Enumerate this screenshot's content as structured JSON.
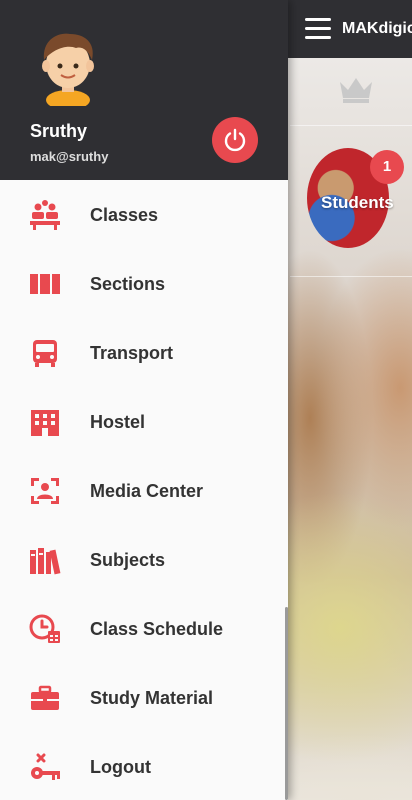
{
  "app": {
    "title": "MAKdigica",
    "tile": {
      "label": "Students",
      "badge": "1"
    }
  },
  "drawer": {
    "user": {
      "name": "Sruthy",
      "email": "mak@sruthy"
    },
    "items": [
      {
        "label": "Classes",
        "icon": "classroom-icon"
      },
      {
        "label": "Sections",
        "icon": "sections-icon"
      },
      {
        "label": "Transport",
        "icon": "bus-icon"
      },
      {
        "label": "Hostel",
        "icon": "building-icon"
      },
      {
        "label": "Media Center",
        "icon": "media-center-icon"
      },
      {
        "label": "Subjects",
        "icon": "books-icon"
      },
      {
        "label": "Class Schedule",
        "icon": "clock-calendar-icon"
      },
      {
        "label": "Study Material",
        "icon": "briefcase-icon"
      },
      {
        "label": "Logout",
        "icon": "key-logout-icon"
      }
    ]
  },
  "colors": {
    "accent": "#e8494f",
    "header": "#2f2f33",
    "drawer_bg": "#fafafa",
    "text": "#333333"
  }
}
